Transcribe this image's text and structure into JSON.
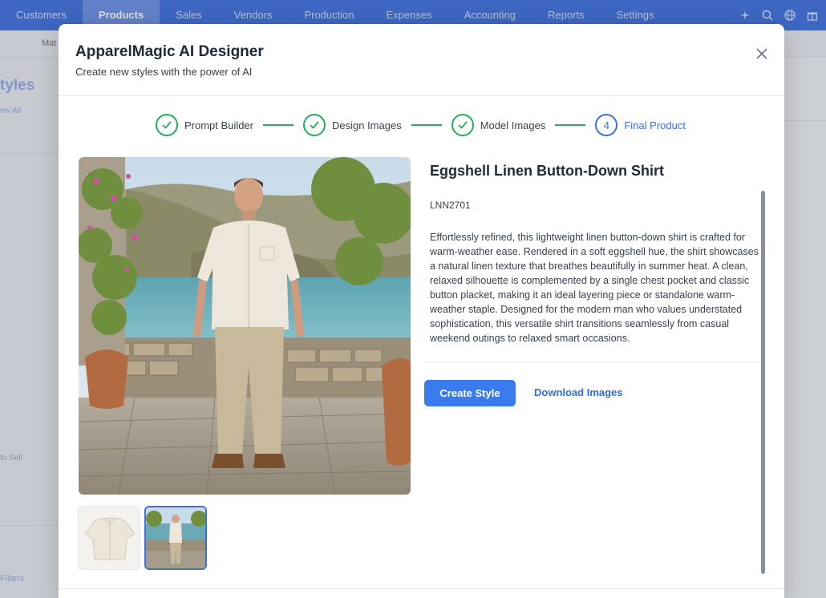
{
  "app": {
    "nav": [
      "Customers",
      "Products",
      "Sales",
      "Vendors",
      "Production",
      "Expenses",
      "Accounting",
      "Reports",
      "Settings"
    ],
    "active_nav": "Products",
    "nav_icons": [
      "sparkle-icon",
      "search-icon",
      "globe-icon",
      "gift-icon"
    ],
    "subnav_item": "Mat",
    "bg_title": "tyles",
    "bg_view_all": "ew All",
    "bg_to_sell": "to Sell",
    "bg_filters": "Filters"
  },
  "modal": {
    "title": "ApparelMagic AI Designer",
    "subtitle": "Create new styles with the power of AI",
    "close_icon": "close-icon"
  },
  "stepper": {
    "steps": [
      {
        "label": "Prompt Builder",
        "status": "complete"
      },
      {
        "label": "Design Images",
        "status": "complete"
      },
      {
        "label": "Model Images",
        "status": "complete"
      },
      {
        "label": "Final Product",
        "status": "current",
        "number": "4"
      }
    ]
  },
  "product": {
    "name": "Eggshell Linen Button-Down Shirt",
    "code": "LNN2701",
    "description": "Effortlessly refined, this lightweight linen button-down shirt is crafted for warm-weather ease. Rendered in a soft eggshell hue, the shirt showcases a natural linen texture that breathes beautifully in summer heat. A clean, relaxed silhouette is complemented by a single chest pocket and classic button placket, making it an ideal layering piece or standalone warm-weather staple. Designed for the modern man who values understated sophistication, this versatile shirt transitions seamlessly from casual weekend outings to relaxed smart occasions."
  },
  "actions": {
    "create_style": "Create Style",
    "download_images": "Download Images"
  },
  "colors": {
    "accent": "#3b7bf0",
    "complete": "#22b05a",
    "nav_bg": "#3d6fdc"
  }
}
